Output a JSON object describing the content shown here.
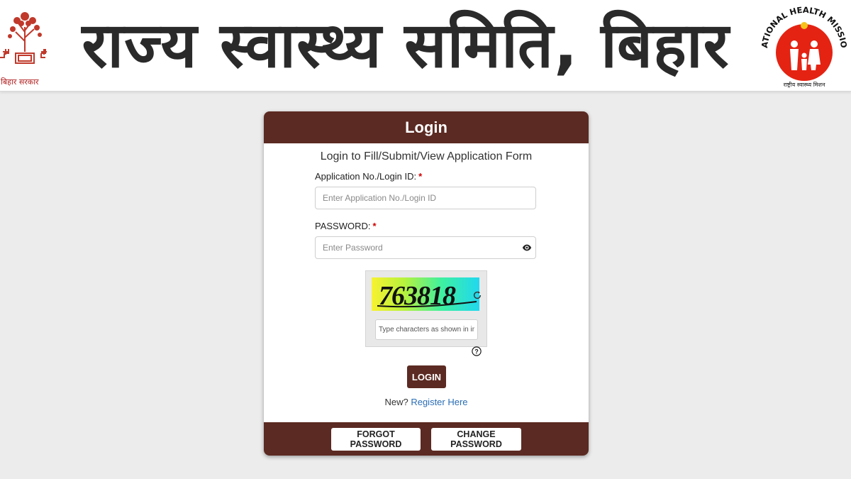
{
  "header": {
    "title": "राज्य स्वास्थ्य समिति, बिहार",
    "left_logo_caption": "बिहार सरकार",
    "right_logo_text": "NATIONAL HEALTH MISSION",
    "right_logo_caption": "राष्ट्रीय स्वास्थ्य मिशन"
  },
  "login": {
    "title": "Login",
    "subtitle": "Login to Fill/Submit/View Application Form",
    "login_id_label": "Application No./Login ID:",
    "login_id_placeholder": "Enter Application No./Login ID",
    "password_label": "PASSWORD:",
    "password_placeholder": "Enter Password",
    "required_mark": "*",
    "captcha_text": "763818",
    "captcha_placeholder": "Type characters as shown in image",
    "help_glyph": "?",
    "login_button": "LOGIN",
    "new_text": "New?",
    "register_link": "Register Here",
    "forgot_password_button": "FORGOT PASSWORD",
    "change_password_button": "CHANGE PASSWORD"
  },
  "colors": {
    "accent": "#5b2a22",
    "link": "#2a6db5",
    "required": "#d10000",
    "page_bg": "#ececec"
  },
  "icons": {
    "password_toggle": "eye-icon",
    "captcha_refresh": "refresh-icon",
    "captcha_help": "help-icon"
  }
}
